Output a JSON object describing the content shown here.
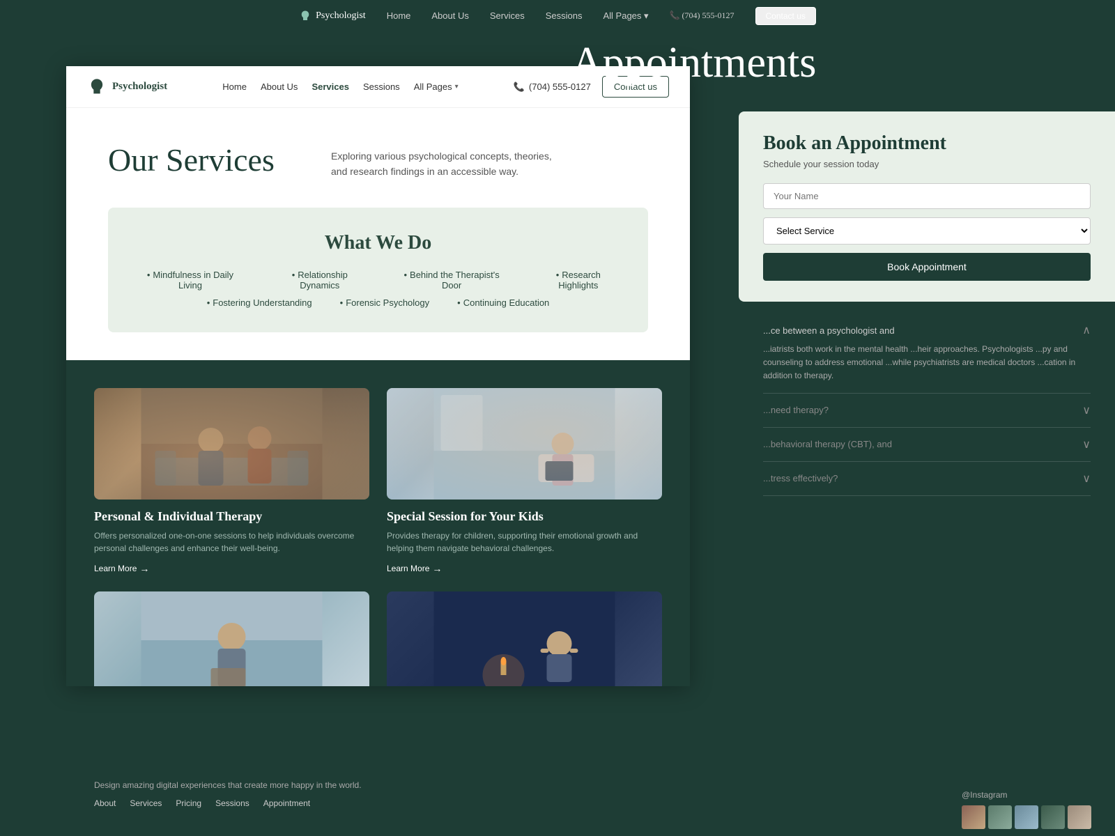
{
  "bg": {
    "color": "#1e3d35"
  },
  "top_navbar": {
    "logo": "Psychologist",
    "links": [
      "Home",
      "About Us",
      "Services",
      "Sessions",
      "All Pages"
    ],
    "phone": "(704) 555-0127",
    "contact_btn": "Contact us"
  },
  "main_navbar": {
    "logo": "Psychologist",
    "links": [
      "Home",
      "About Us",
      "Services",
      "Sessions",
      "All Pages"
    ],
    "phone": "(704) 555-0127",
    "contact_btn": "Contact us"
  },
  "services_section": {
    "title": "Our Services",
    "description": "Exploring various psychological concepts, theories, and research findings in an accessible way."
  },
  "what_we_do": {
    "title": "What We Do",
    "row1": [
      "Mindfulness in Daily Living",
      "Relationship Dynamics",
      "Behind the Therapist's Door",
      "Research Highlights"
    ],
    "row2": [
      "Fostering Understanding",
      "Forensic Psychology",
      "Continuing Education"
    ]
  },
  "service_cards": [
    {
      "title": "Personal & Individual Therapy",
      "description": "Offers personalized one-on-one sessions to help individuals overcome personal challenges and enhance their well-being.",
      "learn_more": "Learn More"
    },
    {
      "title": "Special Session for Your Kids",
      "description": "Provides therapy for children, supporting their emotional growth and helping them navigate behavioral challenges.",
      "learn_more": "Learn More"
    },
    {
      "title": "",
      "description": "",
      "learn_more": ""
    },
    {
      "title": "",
      "description": "",
      "learn_more": ""
    }
  ],
  "appointments": {
    "title": "Appointments",
    "card_title": "Book an Appointment",
    "card_subtitle": "Schedule your session today",
    "form": {
      "name_placeholder": "Your Name",
      "select_placeholder": "Select Service",
      "submit_label": "Book Appointment"
    }
  },
  "faq": {
    "items": [
      {
        "question": "...ce between a psychologist and",
        "answer": "...iatrists both work in the mental health ...heir approaches. Psychologists ...py and counseling to address emotional ...while psychiatrists are medical doctors ...cation in addition to therapy.",
        "open": true
      },
      {
        "question": "...need therapy?",
        "answer": "",
        "open": false
      },
      {
        "question": "...behavioral therapy (CBT), and",
        "answer": "",
        "open": false
      },
      {
        "question": "...tress effectively?",
        "answer": "",
        "open": false
      }
    ]
  },
  "footer": {
    "description": "Design amazing digital experiences that create more happy in the world.",
    "links": [
      "About",
      "Services",
      "Pricing",
      "Sessions",
      "Appointment"
    ],
    "instagram_label": "@Instagram"
  }
}
